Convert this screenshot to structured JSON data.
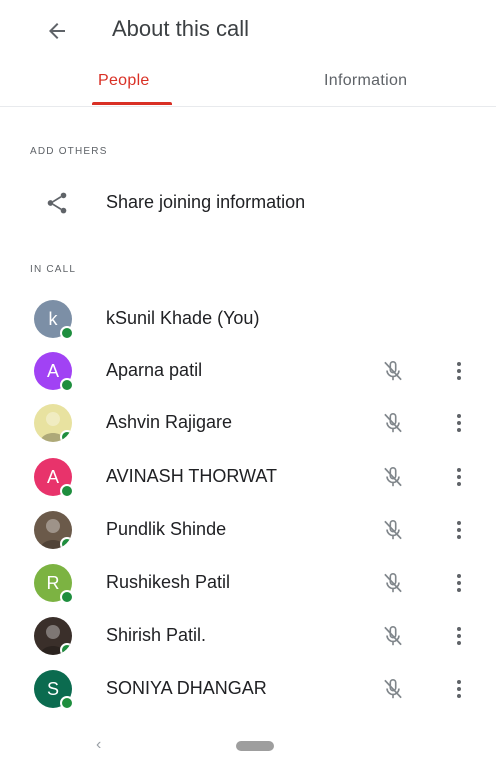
{
  "header": {
    "title": "About this call",
    "back_icon": "arrow-back-icon"
  },
  "tabs": [
    {
      "label": "People",
      "active": true
    },
    {
      "label": "Information",
      "active": false
    }
  ],
  "add_others": {
    "section_label": "ADD OTHERS",
    "share": {
      "label": "Share joining information",
      "icon": "share-icon"
    }
  },
  "in_call": {
    "section_label": "IN CALL",
    "people": [
      {
        "name": "kSunil Khade (You)",
        "initial": "k",
        "avatar_color": "#7c8fa6",
        "photo": false,
        "controls": false
      },
      {
        "name": "Aparna patil",
        "initial": "A",
        "avatar_color": "#a142f4",
        "photo": false,
        "controls": true
      },
      {
        "name": "Ashvin Rajigare",
        "initial": "",
        "avatar_color": "#e8e2a0",
        "photo": true,
        "controls": true
      },
      {
        "name": "AVINASH THORWAT",
        "initial": "A",
        "avatar_color": "#e8336b",
        "photo": false,
        "controls": true
      },
      {
        "name": "Pundlik Shinde",
        "initial": "",
        "avatar_color": "#6b5a4a",
        "photo": true,
        "controls": true
      },
      {
        "name": "Rushikesh Patil",
        "initial": "R",
        "avatar_color": "#7cb342",
        "photo": false,
        "controls": true
      },
      {
        "name": "Shirish Patil.",
        "initial": "",
        "avatar_color": "#3a2f2a",
        "photo": true,
        "controls": true
      },
      {
        "name": "SONIYA DHANGAR",
        "initial": "S",
        "avatar_color": "#0b6b4f",
        "photo": false,
        "controls": true
      }
    ]
  },
  "colors": {
    "accent": "#d93025",
    "presence": "#1e8e3e"
  }
}
